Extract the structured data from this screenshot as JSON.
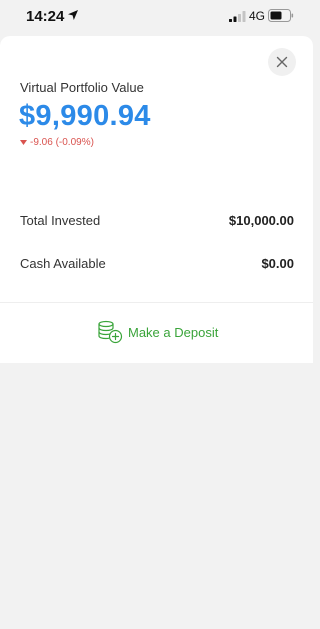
{
  "status_bar": {
    "time": "14:24",
    "network": "4G",
    "icons": [
      "location-arrow-icon",
      "signal-bars-icon",
      "battery-icon"
    ]
  },
  "portfolio": {
    "label": "Virtual Portfolio Value",
    "value": "$9,990.94",
    "change": "-9.06 (-0.09%)",
    "change_color": "#d9534f",
    "value_color": "#2c8ae8"
  },
  "details": [
    {
      "label": "Total Invested",
      "value": "$10,000.00"
    },
    {
      "label": "Cash Available",
      "value": "$0.00"
    }
  ],
  "actions": {
    "deposit_label": "Make a Deposit",
    "deposit_icon": "coins-plus-icon",
    "accent_color": "#3aa43a",
    "close_icon": "close-icon"
  }
}
